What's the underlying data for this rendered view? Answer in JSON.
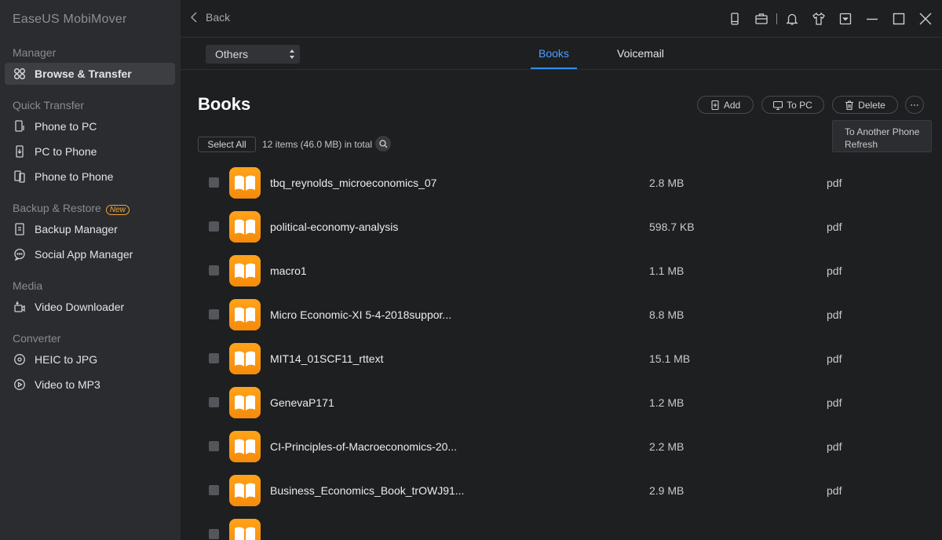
{
  "app": {
    "title": "EaseUS MobiMover"
  },
  "sidebar": {
    "sections": [
      {
        "title": "Manager",
        "items": [
          {
            "label": "Browse & Transfer",
            "icon": "grid-icon"
          }
        ]
      },
      {
        "title": "Quick Transfer",
        "items": [
          {
            "label": "Phone to PC",
            "icon": "phone-to-pc-icon"
          },
          {
            "label": "PC to Phone",
            "icon": "pc-to-phone-icon"
          },
          {
            "label": "Phone to Phone",
            "icon": "phone-to-phone-icon"
          }
        ]
      },
      {
        "title": "Backup & Restore",
        "badge": "New",
        "items": [
          {
            "label": "Backup Manager",
            "icon": "backup-icon"
          },
          {
            "label": "Social App Manager",
            "icon": "chat-icon"
          }
        ]
      },
      {
        "title": "Media",
        "items": [
          {
            "label": "Video Downloader",
            "icon": "download-icon"
          }
        ]
      },
      {
        "title": "Converter",
        "items": [
          {
            "label": "HEIC to JPG",
            "icon": "image-convert-icon"
          },
          {
            "label": "Video to MP3",
            "icon": "audio-convert-icon"
          }
        ]
      }
    ]
  },
  "topbar": {
    "back_label": "Back"
  },
  "subbar": {
    "category_select": "Others",
    "tabs": [
      {
        "label": "Books",
        "active": true
      },
      {
        "label": "Voicemail",
        "active": false
      }
    ]
  },
  "content": {
    "title": "Books",
    "actions": {
      "add": "Add",
      "to_pc": "To PC",
      "delete": "Delete"
    },
    "more_menu": [
      "To Another Phone",
      "Refresh"
    ],
    "select_all": "Select All",
    "count_text": "12 items (46.0 MB) in total"
  },
  "files": [
    {
      "name": "tbq_reynolds_microeconomics_07",
      "size": "2.8 MB",
      "type": "pdf"
    },
    {
      "name": "political-economy-analysis",
      "size": "598.7 KB",
      "type": "pdf"
    },
    {
      "name": "macro1",
      "size": "1.1 MB",
      "type": "pdf"
    },
    {
      "name": "Micro Economic-XI 5-4-2018suppor...",
      "size": "8.8 MB",
      "type": "pdf"
    },
    {
      "name": "MIT14_01SCF11_rttext",
      "size": "15.1 MB",
      "type": "pdf"
    },
    {
      "name": "GenevaP171",
      "size": "1.2 MB",
      "type": "pdf"
    },
    {
      "name": "CI-Principles-of-Macroeconomics-20...",
      "size": "2.2 MB",
      "type": "pdf"
    },
    {
      "name": "Business_Economics_Book_trOWJ91...",
      "size": "2.9 MB",
      "type": "pdf"
    },
    {
      "name": "",
      "size": "",
      "type": ""
    }
  ],
  "colors": {
    "accent": "#2f8cff",
    "book_icon": "#f7940f",
    "sidebar_bg": "#2b2c2f",
    "main_bg": "#1e1f21"
  }
}
